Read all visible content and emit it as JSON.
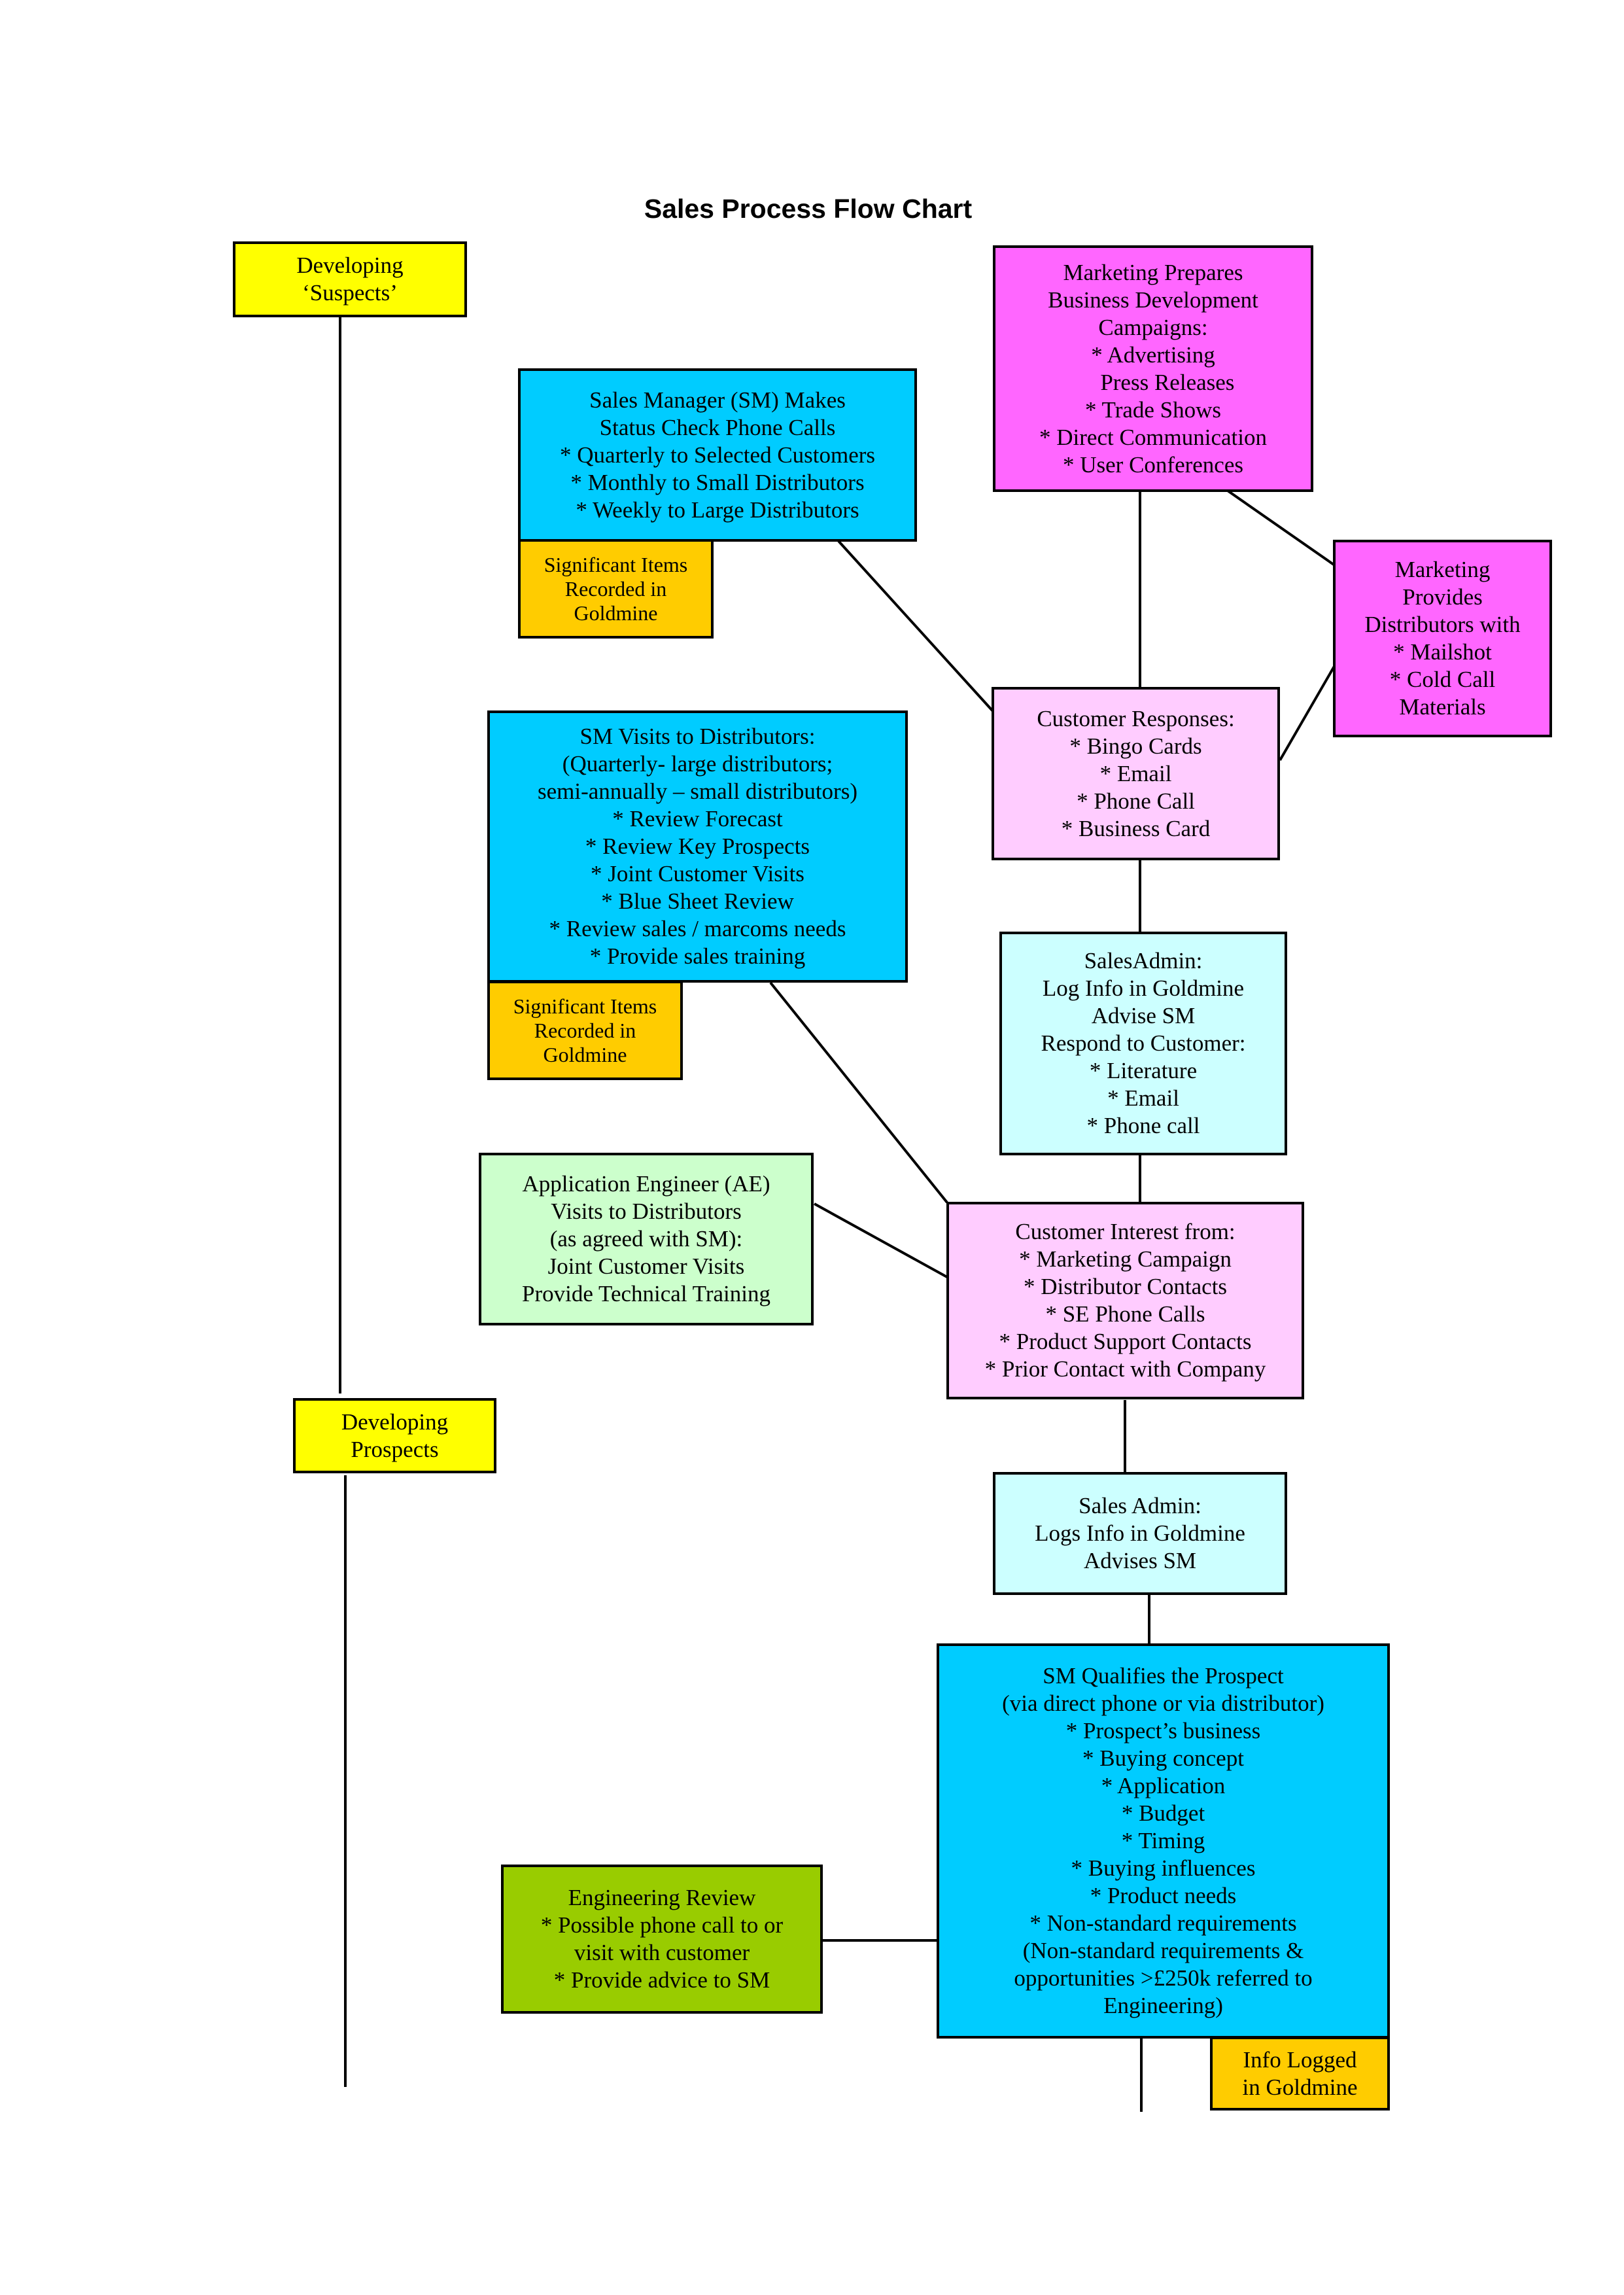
{
  "title": "Sales Process Flow Chart",
  "colors": {
    "stage": "#ffff00",
    "marketing": "#ff66ff",
    "sales_manager": "#00ccff",
    "goldmine_log": "#ffcc00",
    "customer": "#ffccff",
    "sales_admin": "#ccffff",
    "application_engineer": "#ccffcc",
    "engineering": "#99cc00",
    "line": "#000000"
  },
  "nodes": {
    "developing_suspects": {
      "lines": [
        "Developing",
        "‘Suspects’"
      ]
    },
    "marketing_campaigns": {
      "lines": [
        "Marketing Prepares",
        "Business Development",
        "Campaigns:",
        "* Advertising",
        "     Press Releases",
        "* Trade Shows",
        "* Direct Communication",
        "* User Conferences"
      ]
    },
    "sm_status_calls": {
      "lines": [
        "Sales Manager (SM) Makes",
        "Status Check Phone Calls",
        "* Quarterly to Selected Customers",
        "* Monthly to Small Distributors",
        "* Weekly to Large Distributors"
      ]
    },
    "significant_items_1": {
      "lines": [
        "Significant Items",
        "Recorded in",
        "Goldmine"
      ]
    },
    "marketing_distributors": {
      "lines": [
        "Marketing",
        "Provides",
        "Distributors with",
        "* Mailshot",
        "* Cold Call",
        "Materials"
      ]
    },
    "customer_responses": {
      "lines": [
        "Customer Responses:",
        "* Bingo Cards",
        "* Email",
        "* Phone Call",
        "* Business Card"
      ]
    },
    "sm_visits": {
      "lines": [
        "SM Visits to Distributors:",
        "(Quarterly- large distributors;",
        "semi-annually – small distributors)",
        "* Review Forecast",
        "* Review Key Prospects",
        "* Joint Customer Visits",
        "* Blue Sheet Review",
        "* Review sales / marcoms needs",
        "* Provide sales training"
      ]
    },
    "significant_items_2": {
      "lines": [
        "Significant Items",
        "Recorded in",
        "Goldmine"
      ]
    },
    "sales_admin_1": {
      "lines": [
        "SalesAdmin:",
        "Log Info in Goldmine",
        "Advise SM",
        "Respond to Customer:",
        "* Literature",
        "* Email",
        "* Phone call"
      ]
    },
    "application_engineer": {
      "lines": [
        "Application Engineer (AE)",
        "Visits to Distributors",
        "(as agreed with SM):",
        "Joint Customer Visits",
        "Provide Technical Training"
      ]
    },
    "customer_interest": {
      "lines": [
        "Customer Interest from:",
        "* Marketing Campaign",
        "* Distributor Contacts",
        "* SE Phone Calls",
        "* Product Support Contacts",
        "* Prior Contact with Company"
      ]
    },
    "developing_prospects": {
      "lines": [
        "Developing",
        "Prospects"
      ]
    },
    "sales_admin_2": {
      "lines": [
        "Sales Admin:",
        "Logs Info in Goldmine",
        "Advises SM"
      ]
    },
    "sm_qualifies": {
      "lines": [
        "SM Qualifies the Prospect",
        "(via direct phone or via distributor)",
        "* Prospect’s business",
        "* Buying concept",
        "* Application",
        "* Budget",
        "* Timing",
        "* Buying influences",
        "* Product needs",
        "* Non-standard requirements",
        "(Non-standard requirements &",
        "opportunities >£250k referred to",
        "Engineering)"
      ]
    },
    "engineering_review": {
      "lines": [
        "Engineering Review",
        "* Possible phone call to or",
        "visit with customer",
        "* Provide advice to SM"
      ]
    },
    "info_logged": {
      "lines": [
        "Info Logged",
        "in Goldmine"
      ]
    }
  },
  "connections": [
    [
      "developing_suspects",
      "developing_prospects"
    ],
    [
      "marketing_campaigns",
      "customer_responses"
    ],
    [
      "marketing_campaigns",
      "marketing_distributors"
    ],
    [
      "marketing_distributors",
      "customer_responses"
    ],
    [
      "sm_status_calls",
      "customer_responses"
    ],
    [
      "customer_responses",
      "sales_admin_1"
    ],
    [
      "sales_admin_1",
      "customer_interest"
    ],
    [
      "sm_visits",
      "customer_interest"
    ],
    [
      "application_engineer",
      "customer_interest"
    ],
    [
      "customer_interest",
      "sales_admin_2"
    ],
    [
      "sales_admin_2",
      "sm_qualifies"
    ],
    [
      "engineering_review",
      "sm_qualifies"
    ]
  ]
}
